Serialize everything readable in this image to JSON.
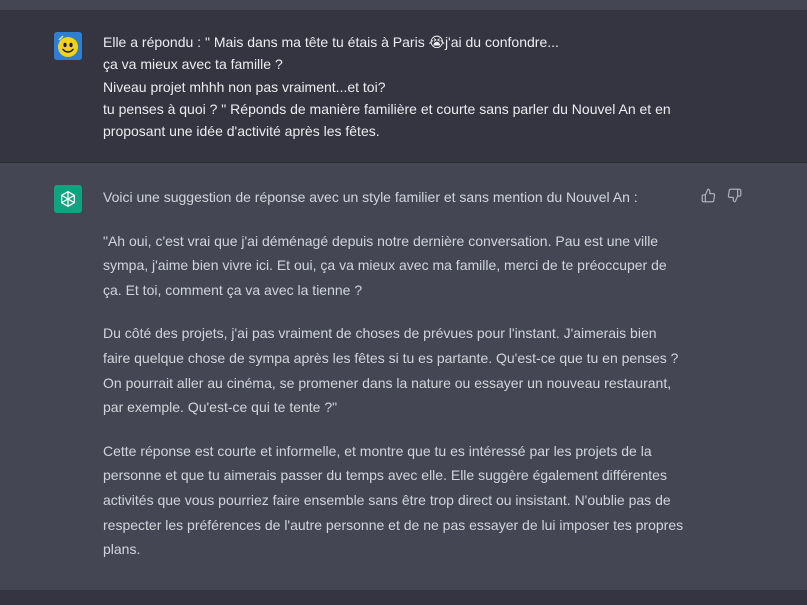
{
  "user_message": {
    "lines": [
      "Elle a répondu : \" Mais dans ma tête tu étais à Paris 😭j'ai du confondre...",
      "ça va mieux avec ta famille ?",
      "Niveau projet mhhh non pas vraiment...et toi?",
      "tu penses à quoi ?  \" Réponds de manière familière et courte sans parler du Nouvel An et en",
      "proposant une idée d'activité après les fêtes."
    ]
  },
  "assistant_message": {
    "intro": "Voici une suggestion de réponse avec un style familier et sans mention du Nouvel An :",
    "paragraph1": [
      "\"Ah oui, c'est vrai que j'ai déménagé depuis notre dernière conversation. Pau est une ville",
      "sympa, j'aime bien vivre ici. Et oui, ça va mieux avec ma famille, merci de te préoccuper de",
      "ça. Et toi, comment ça va avec la tienne ?"
    ],
    "paragraph2": [
      "Du côté des projets, j'ai pas vraiment de choses de prévues pour l'instant. J'aimerais bien",
      "faire quelque chose de sympa après les fêtes si tu es partante. Qu'est-ce que tu en penses ?",
      "On pourrait aller au cinéma, se promener dans la nature ou essayer un nouveau restaurant,",
      "par exemple. Qu'est-ce qui te tente ?\""
    ],
    "paragraph3": [
      "Cette réponse est courte et informelle, et montre que tu es intéressé par les projets de la",
      "personne et que tu aimerais passer du temps avec elle. Elle suggère également différentes",
      "activités que vous pourriez faire ensemble sans être trop direct ou insistant. N'oublie pas de",
      "respecter les préférences de l'autre personne et de ne pas essayer de lui imposer tes propres",
      "plans."
    ]
  },
  "icons": {
    "user_avatar": "smiley-avatar-icon",
    "assistant_avatar": "openai-logo-icon",
    "thumbs_up": "thumbs-up-icon",
    "thumbs_down": "thumbs-down-icon"
  },
  "colors": {
    "user_bg": "#343541",
    "assistant_bg": "#444654",
    "assistant_avatar_bg": "#10a37f"
  }
}
